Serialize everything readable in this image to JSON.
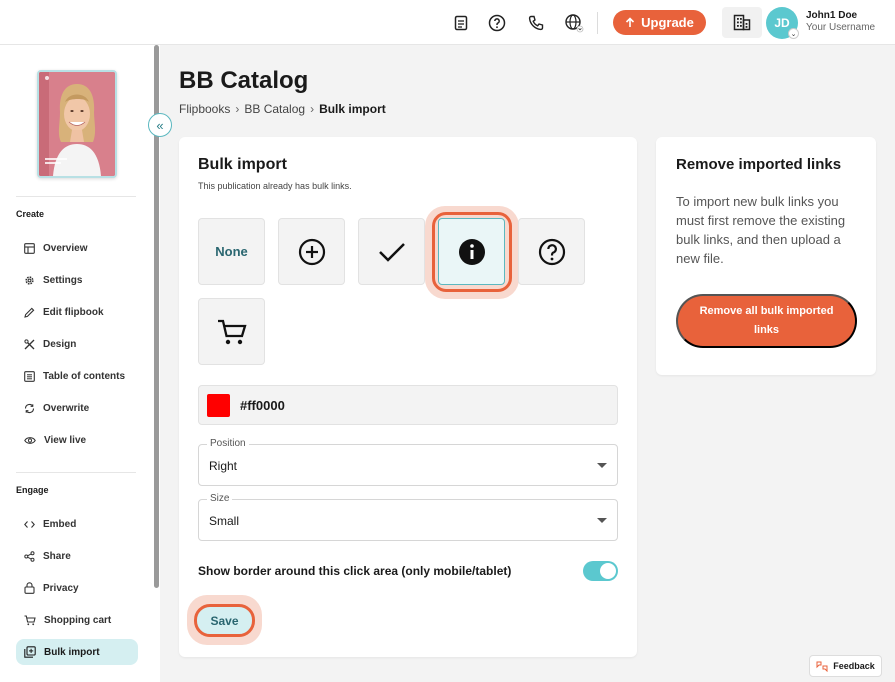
{
  "header": {
    "upgrade_label": "Upgrade",
    "user": {
      "initials": "JD",
      "name": "John1 Doe",
      "username": "Your Username"
    },
    "icons": [
      "document-icon",
      "help-icon",
      "phone-icon",
      "globe-icon",
      "building-icon"
    ]
  },
  "sidebar": {
    "sections": [
      {
        "label": "Create",
        "items": [
          {
            "label": "Overview",
            "icon": "overview-icon"
          },
          {
            "label": "Settings",
            "icon": "gear-icon"
          },
          {
            "label": "Edit flipbook",
            "icon": "pencil-icon"
          },
          {
            "label": "Design",
            "icon": "design-icon"
          },
          {
            "label": "Table of contents",
            "icon": "list-icon"
          },
          {
            "label": "Overwrite",
            "icon": "refresh-icon"
          },
          {
            "label": "View live",
            "icon": "eye-icon"
          }
        ]
      },
      {
        "label": "Engage",
        "items": [
          {
            "label": "Embed",
            "icon": "code-icon"
          },
          {
            "label": "Share",
            "icon": "share-icon"
          },
          {
            "label": "Privacy",
            "icon": "lock-icon"
          },
          {
            "label": "Shopping cart",
            "icon": "cart-icon"
          },
          {
            "label": "Bulk import",
            "icon": "bulk-import-icon",
            "active": true
          }
        ]
      }
    ]
  },
  "page": {
    "title": "BB Catalog",
    "breadcrumb": [
      "Flipbooks",
      "BB Catalog",
      "Bulk import"
    ]
  },
  "bulk": {
    "heading": "Bulk import",
    "subtext": "This publication already has bulk links.",
    "icon_options": [
      {
        "label": "None",
        "icon": "none"
      },
      {
        "icon": "plus-circle-icon"
      },
      {
        "icon": "checkmark-icon"
      },
      {
        "icon": "info-icon",
        "selected": true
      },
      {
        "icon": "question-circle-icon"
      },
      {
        "icon": "cart-icon"
      }
    ],
    "color": {
      "value": "#ff0000",
      "swatch": "#ff0000"
    },
    "position": {
      "label": "Position",
      "value": "Right"
    },
    "size": {
      "label": "Size",
      "value": "Small"
    },
    "border_toggle": {
      "label": "Show border around this click area (only mobile/tablet)",
      "on": true
    },
    "save_label": "Save"
  },
  "remove": {
    "heading": "Remove imported links",
    "description": "To import new bulk links you must first remove the existing bulk links, and then upload a new file.",
    "button_label": "Remove all bulk imported links"
  },
  "feedback_label": "Feedback",
  "colors": {
    "accent": "#e8623b",
    "teal": "#5bc8cf",
    "active_bg": "#d5eff1"
  }
}
